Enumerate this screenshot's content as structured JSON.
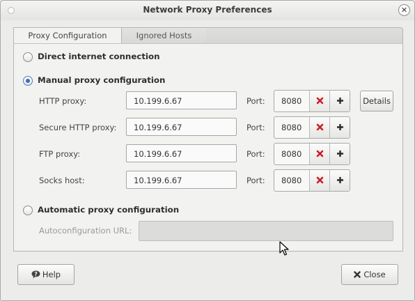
{
  "window": {
    "title": "Network Proxy Preferences"
  },
  "tabs": [
    {
      "label": "Proxy Configuration",
      "active": true
    },
    {
      "label": "Ignored Hosts",
      "active": false
    }
  ],
  "modes": {
    "direct": {
      "label": "Direct internet connection",
      "selected": false
    },
    "manual": {
      "label": "Manual proxy configuration",
      "selected": true
    },
    "automatic": {
      "label": "Automatic proxy configuration",
      "selected": false
    }
  },
  "proxies": [
    {
      "label": "HTTP proxy:",
      "host": "10.199.6.67",
      "port_label": "Port:",
      "port": "8080"
    },
    {
      "label": "Secure HTTP proxy:",
      "host": "10.199.6.67",
      "port_label": "Port:",
      "port": "8080"
    },
    {
      "label": "FTP proxy:",
      "host": "10.199.6.67",
      "port_label": "Port:",
      "port": "8080"
    },
    {
      "label": "Socks host:",
      "host": "10.199.6.67",
      "port_label": "Port:",
      "port": "8080"
    }
  ],
  "details_label": "Details",
  "autoconfig": {
    "label": "Autoconfiguration URL:",
    "value": ""
  },
  "footer": {
    "help_label": "Help",
    "close_label": "Close"
  },
  "icons": {
    "decrement": "red-x-icon",
    "increment": "plus-icon",
    "help": "help-icon",
    "close": "close-icon"
  },
  "colors": {
    "decrement": "#cc1f1f",
    "radio_selected": "#3b6fb6"
  }
}
